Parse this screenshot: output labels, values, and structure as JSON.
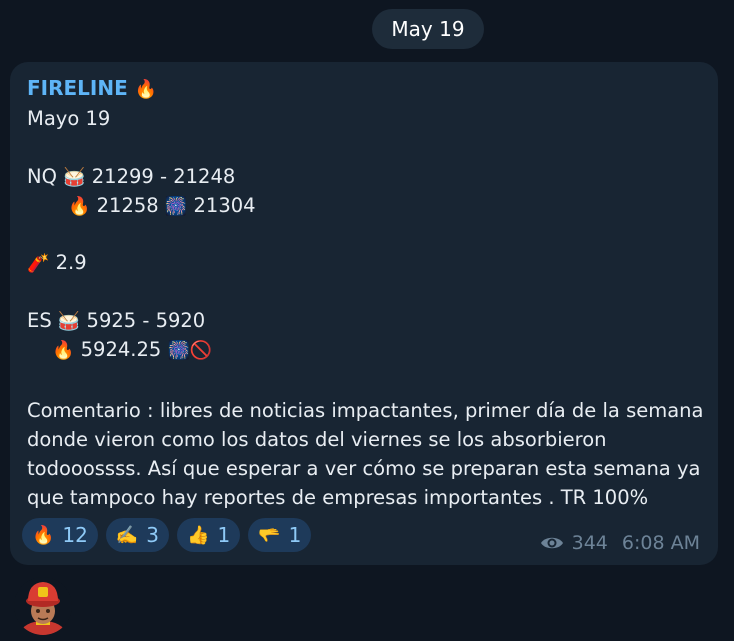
{
  "date_separator": "May 19",
  "message": {
    "author": "FIRELINE",
    "author_emoji": "🔥",
    "date_line": "Mayo 19",
    "nq": {
      "symbol": "NQ",
      "drum_emoji": "🥁",
      "range": "21299 - 21248",
      "fire_emoji": "🔥",
      "fire_value": "21258",
      "burst_emoji": "🎆",
      "burst_value": "21304"
    },
    "dynamite": {
      "emoji": "🧨",
      "value": "2.9"
    },
    "es": {
      "symbol": "ES",
      "drum_emoji": "🥁",
      "range": "5925 - 5920",
      "fire_emoji": "🔥",
      "fire_value": "5924.25",
      "burst_emoji": "🎆",
      "stop_emoji": "🚫"
    },
    "comment": "Comentario : libres de noticias impactantes, primer día de la semana donde vieron como los datos del viernes se los absorbieron todooossss. Así que esperar a ver cómo se preparan esta semana ya que tampoco hay reportes de empresas importantes . TR 100%",
    "reactions": [
      {
        "emoji": "🔥",
        "count": "12"
      },
      {
        "emoji": "✍️",
        "count": "3"
      },
      {
        "emoji": "👍",
        "count": "1"
      },
      {
        "emoji": "🫳",
        "count": "1"
      }
    ],
    "views": "344",
    "time": "6:08 AM",
    "views_icon": "eye-icon"
  },
  "avatar_icon": "firefighter-avatar"
}
